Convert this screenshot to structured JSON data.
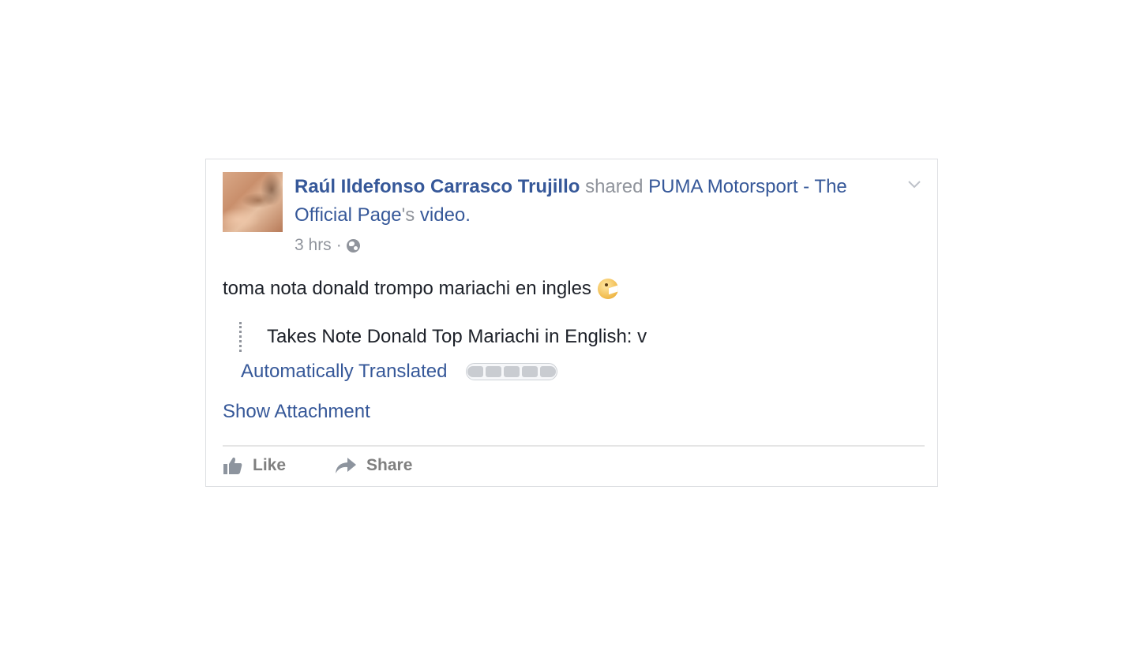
{
  "post": {
    "author": "Raúl Ildefonso Carrasco Trujillo",
    "action_word": " shared ",
    "shared_page": "PUMA Motorsport - The Official Page",
    "possessive": "'s ",
    "shared_object": "video",
    "period": ".",
    "timestamp": "3 hrs",
    "separator": "·",
    "privacy_icon": "globe-icon",
    "message": "toma nota donald trompo mariachi en ingles",
    "emoji": "pacman-emoticon",
    "translation": {
      "text": "Takes Note Donald Top Mariachi in English: v",
      "label": "Automatically Translated",
      "rating_segments": 5
    },
    "show_attachment_label": "Show Attachment",
    "actions": {
      "like_label": "Like",
      "share_label": "Share"
    }
  },
  "colors": {
    "link": "#365899",
    "meta": "#90949c",
    "text": "#1d2129",
    "action": "#7f7f7f",
    "border": "#dddfe2"
  }
}
